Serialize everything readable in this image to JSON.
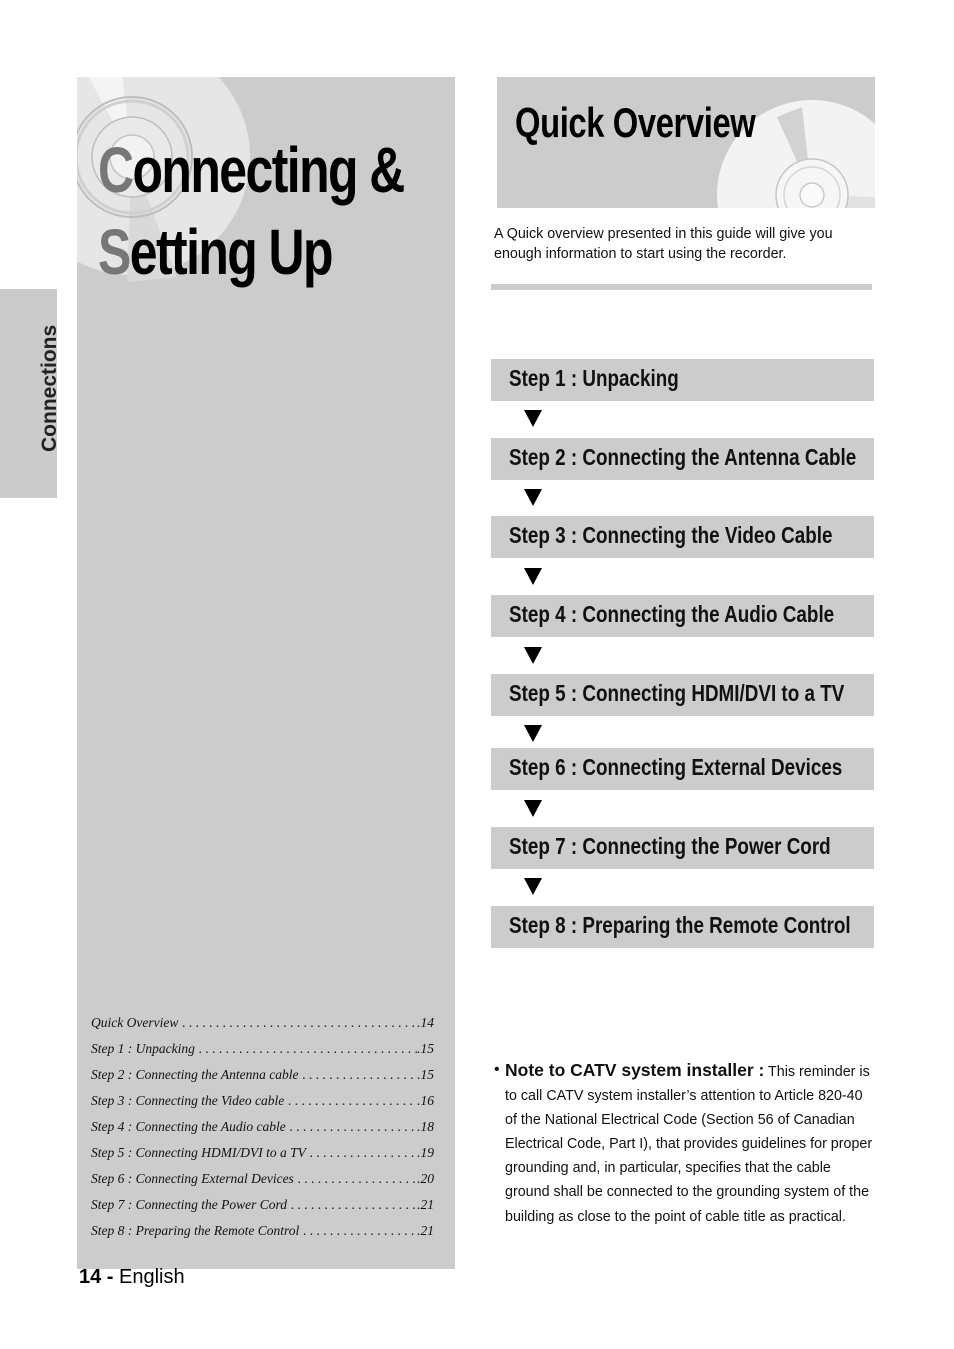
{
  "side_tab": {
    "label": "Connections"
  },
  "chapter": {
    "title_line1_cap": "C",
    "title_line1_rest": "onnecting &",
    "title_line2_cap": "S",
    "title_line2_rest": "etting Up"
  },
  "toc": [
    {
      "label": "Quick Overview",
      "page": ".14"
    },
    {
      "label": "Step 1 : Unpacking",
      "page": ".15"
    },
    {
      "label": "Step 2 : Connecting the Antenna cable",
      "page": ".15"
    },
    {
      "label": "Step 3 : Connecting the Video cable",
      "page": ".16"
    },
    {
      "label": "Step 4 : Connecting the Audio cable",
      "page": ".18"
    },
    {
      "label": "Step 5 : Connecting HDMI/DVI to a TV",
      "page": ".19"
    },
    {
      "label": "Step 6 : Connecting External Devices",
      "page": ".20"
    },
    {
      "label": "Step 7 : Connecting the Power Cord",
      "page": ".21"
    },
    {
      "label": "Step 8 : Preparing the Remote Control",
      "page": ".21"
    }
  ],
  "footer": {
    "page_number": "14 -",
    "language": "English"
  },
  "quick_overview": {
    "title": "Quick Overview",
    "intro": "A Quick overview presented in this guide will give you enough information to start using the recorder."
  },
  "steps": [
    {
      "label": "Step 1 : Unpacking"
    },
    {
      "label": "Step 2 : Connecting the Antenna Cable"
    },
    {
      "label": "Step 3 : Connecting the Video Cable"
    },
    {
      "label": "Step 4 : Connecting the Audio Cable"
    },
    {
      "label": "Step 5 : Connecting HDMI/DVI to a TV"
    },
    {
      "label": "Step 6 : Connecting External Devices"
    },
    {
      "label": "Step 7 : Connecting the Power Cord"
    },
    {
      "label": "Step 8 : Preparing the Remote Control"
    }
  ],
  "note": {
    "bullet": "•",
    "heading": "Note to CATV system installer :",
    "text": " This reminder is to call CATV system installer’s attention to Article 820-40 of the National Electrical Code (Section 56 of Canadian Electrical Code, Part I), that provides guidelines for proper grounding and, in particular, specifies that the cable ground shall be connected to the grounding system of the building as close to the point of cable title as practical."
  }
}
